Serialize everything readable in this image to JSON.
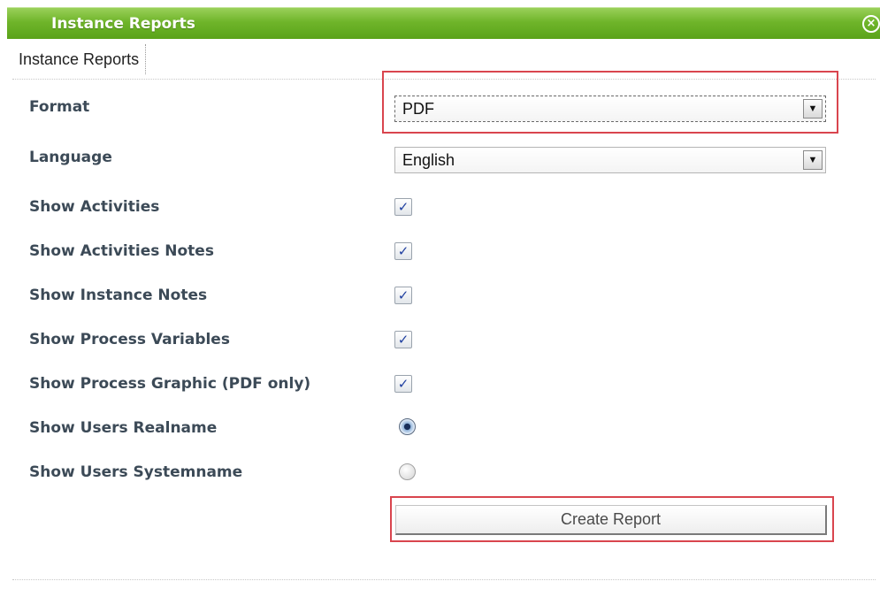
{
  "window": {
    "title": "Instance Reports",
    "close_icon": "close-circle-icon"
  },
  "tab": {
    "label": "Instance Reports"
  },
  "form": {
    "format": {
      "label": "Format",
      "value": "PDF"
    },
    "language": {
      "label": "Language",
      "value": "English"
    },
    "show_activities": {
      "label": "Show Activities",
      "checked": true,
      "mark": "✓"
    },
    "show_activities_notes": {
      "label": "Show Activities Notes",
      "checked": true,
      "mark": "✓"
    },
    "show_instance_notes": {
      "label": "Show Instance Notes",
      "checked": true,
      "mark": "✓"
    },
    "show_process_variables": {
      "label": "Show Process Variables",
      "checked": true,
      "mark": "✓"
    },
    "show_process_graphic": {
      "label": "Show Process Graphic (PDF only)",
      "checked": true,
      "mark": "✓"
    },
    "show_users_realname": {
      "label": "Show Users Realname",
      "selected": true
    },
    "show_users_systemname": {
      "label": "Show Users Systemname",
      "selected": false
    },
    "create_button": {
      "label": "Create Report"
    }
  },
  "colors": {
    "titlebar": "#6fb52a",
    "highlight": "#d9454e",
    "label": "#3c4a57"
  }
}
